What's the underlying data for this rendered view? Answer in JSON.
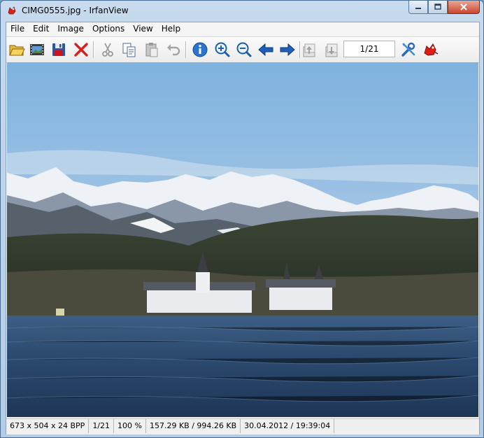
{
  "window": {
    "title": "CIMG0555.jpg - IrfanView"
  },
  "menu": [
    "File",
    "Edit",
    "Image",
    "Options",
    "View",
    "Help"
  ],
  "toolbar": {
    "buttons": [
      "open-folder-icon",
      "slideshow-icon",
      "save-icon",
      "delete-icon",
      "cut-icon",
      "copy-icon",
      "paste-icon",
      "undo-icon",
      "info-icon",
      "zoom-in-icon",
      "zoom-out-icon",
      "previous-arrow-icon",
      "next-arrow-icon",
      "previous-page-icon",
      "next-page-icon",
      "settings-icon",
      "irfanview-logo-icon"
    ],
    "page_counter": "1/21"
  },
  "image": {
    "subject": "lake-castle-mountains-photo"
  },
  "statusbar": {
    "dimensions": "673 x 504 x 24 BPP",
    "index": "1/21",
    "zoom": "100 %",
    "size": "157.29 KB / 994.26 KB",
    "datetime": "30.04.2012 / 19:39:04"
  },
  "colors": {
    "sky": "#9dc2e3",
    "water": "#2e4a6e",
    "accent": "#1f5fb8"
  }
}
